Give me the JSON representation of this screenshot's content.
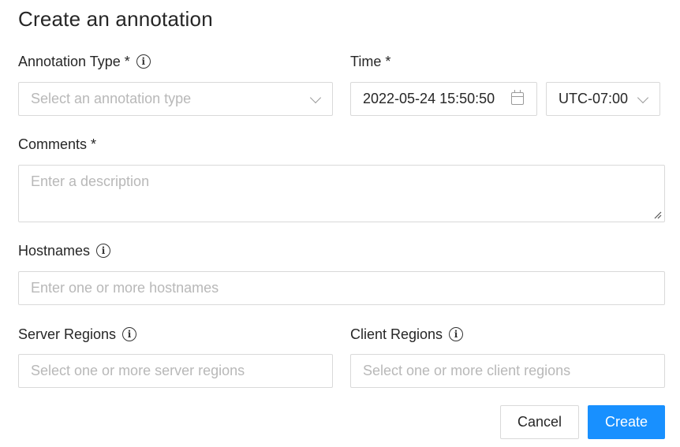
{
  "dialog": {
    "title": "Create an annotation"
  },
  "annotation_type": {
    "label": "Annotation Type *",
    "placeholder": "Select an annotation type"
  },
  "time": {
    "label": "Time *",
    "datetime_value": "2022-05-24 15:50:50",
    "timezone_value": "UTC-07:00"
  },
  "comments": {
    "label": "Comments *",
    "placeholder": "Enter a description"
  },
  "hostnames": {
    "label": "Hostnames",
    "placeholder": "Enter one or more hostnames"
  },
  "server_regions": {
    "label": "Server Regions",
    "placeholder": "Select one or more server regions"
  },
  "client_regions": {
    "label": "Client Regions",
    "placeholder": "Select one or more client regions"
  },
  "actions": {
    "cancel_label": "Cancel",
    "create_label": "Create"
  },
  "icons": {
    "info": "info-icon",
    "calendar": "calendar-icon",
    "chevron": "chevron-down-icon"
  },
  "colors": {
    "primary": "#1890ff",
    "border": "#d9d9d9",
    "placeholder": "#b8b8b8"
  }
}
